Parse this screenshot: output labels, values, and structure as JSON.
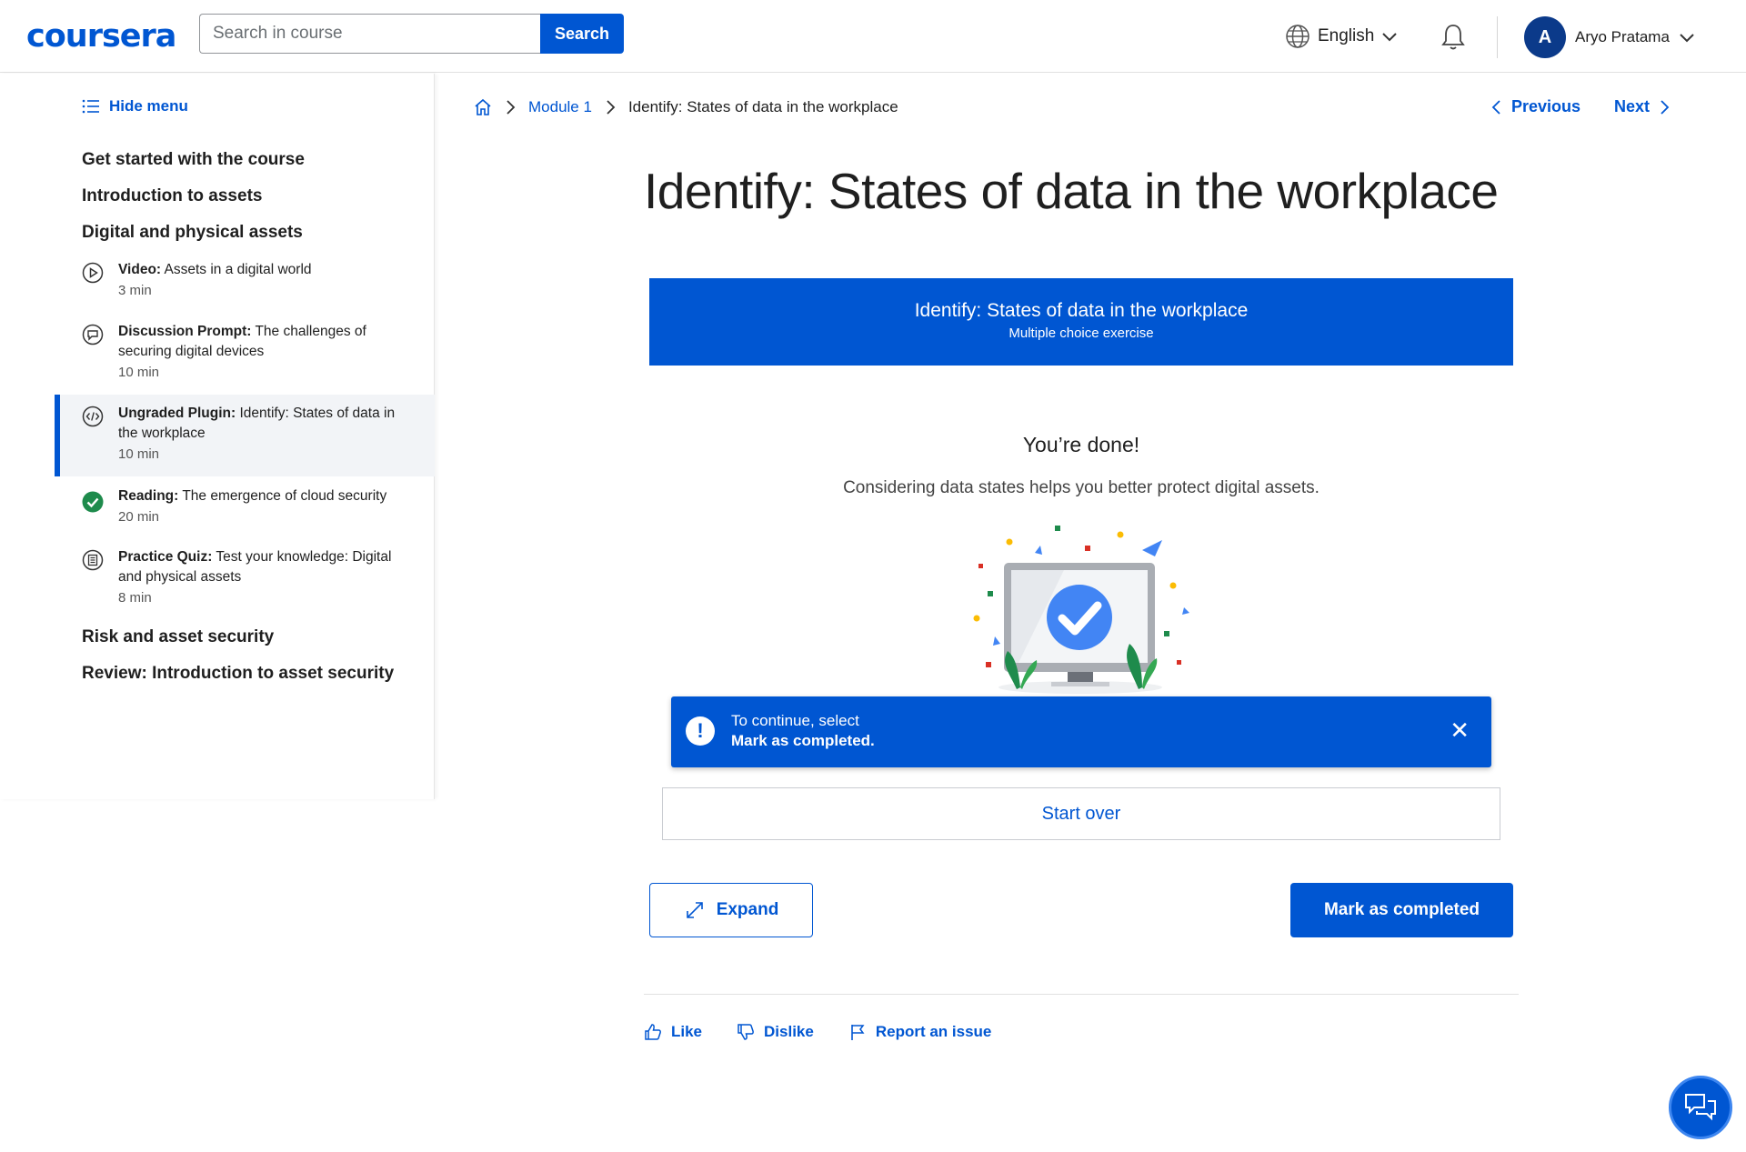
{
  "header": {
    "logo": "coursera",
    "search_placeholder": "Search in course",
    "search_button": "Search",
    "language": "English",
    "user_initial": "A",
    "user_name": "Aryo Pratama"
  },
  "sidebar": {
    "hide_menu": "Hide menu",
    "sections": [
      "Get started with the course",
      "Introduction to assets",
      "Digital and physical assets",
      "Risk and asset security",
      "Review: Introduction to asset security"
    ],
    "items": [
      {
        "type": "Video:",
        "title": "Assets in a digital world",
        "duration": "3 min",
        "icon": "play-icon"
      },
      {
        "type": "Discussion Prompt:",
        "title": "The challenges of securing digital devices",
        "duration": "10 min",
        "icon": "discussion-icon"
      },
      {
        "type": "Ungraded Plugin:",
        "title": "Identify: States of data in the workplace",
        "duration": "10 min",
        "icon": "code-icon"
      },
      {
        "type": "Reading:",
        "title": "The emergence of cloud security",
        "duration": "20 min",
        "icon": "completed-check-icon"
      },
      {
        "type": "Practice Quiz:",
        "title": "Test your knowledge: Digital and physical assets",
        "duration": "8 min",
        "icon": "quiz-icon"
      }
    ]
  },
  "breadcrumb": {
    "module": "Module 1",
    "current": "Identify: States of data in the workplace"
  },
  "nav": {
    "previous": "Previous",
    "next": "Next"
  },
  "main": {
    "title": "Identify: States of data in the workplace",
    "banner_title": "Identify: States of data in the workplace",
    "banner_subtitle": "Multiple choice exercise",
    "done_title": "You’re done!",
    "done_subtitle": "Considering data states helps you better protect digital assets.",
    "alert_line1": "To continue, select",
    "alert_line2": "Mark as completed.",
    "start_over": "Start over",
    "expand": "Expand",
    "mark_completed": "Mark as completed"
  },
  "footer_actions": {
    "like": "Like",
    "dislike": "Dislike",
    "report": "Report an issue"
  },
  "colors": {
    "brand_blue": "#0056d2",
    "success_green": "#1e8b4c"
  }
}
